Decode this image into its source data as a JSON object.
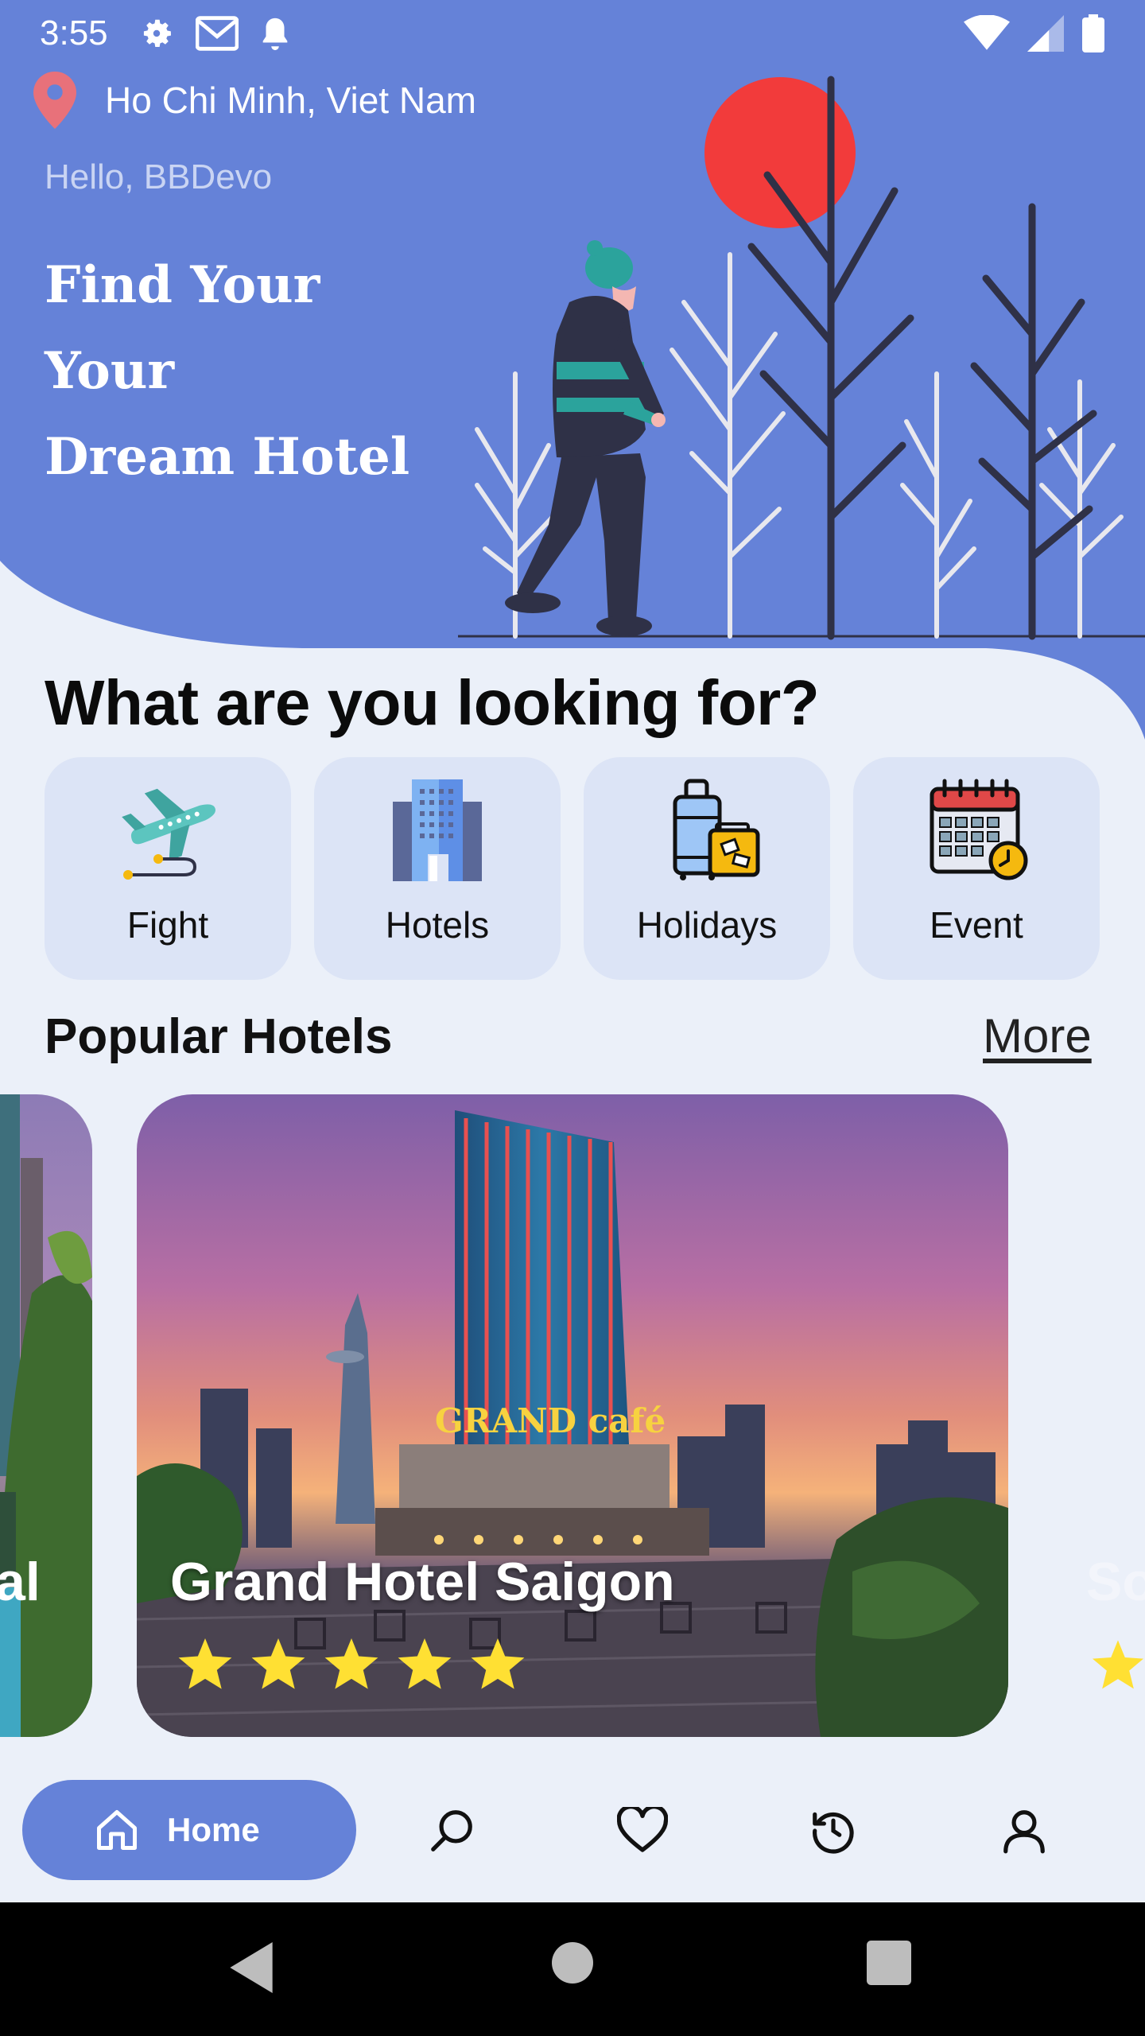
{
  "colors": {
    "primary": "#6582D8",
    "background": "#EBF0F9",
    "card": "#DCE4F6",
    "sun": "#F23B3B",
    "star": "#FFE033"
  },
  "status_bar": {
    "time": "3:55",
    "icons": [
      "settings-icon",
      "gmail-icon",
      "notification-bell-icon",
      "wifi-icon",
      "signal-icon",
      "battery-icon"
    ]
  },
  "header": {
    "location": "Ho Chi Minh, Viet Nam",
    "greeting": "Hello, BBDevo",
    "title_lines": [
      "Find Your",
      "Your",
      "Dream Hotel"
    ]
  },
  "categories_section": {
    "title": "What are you looking for?",
    "items": [
      {
        "label": "Fight",
        "icon": "airplane-icon"
      },
      {
        "label": "Hotels",
        "icon": "hotel-building-icon"
      },
      {
        "label": "Holidays",
        "icon": "luggage-icon"
      },
      {
        "label": "Event",
        "icon": "calendar-icon"
      }
    ]
  },
  "popular_section": {
    "title": "Popular Hotels",
    "more_label": "More",
    "hotels": [
      {
        "name": "al"
      },
      {
        "name": "Grand Hotel Saigon",
        "rating": 5
      },
      {
        "name": "So"
      }
    ]
  },
  "bottom_nav": {
    "home_label": "Home",
    "items": [
      "home-icon",
      "search-icon",
      "heart-icon",
      "history-icon",
      "profile-icon"
    ]
  },
  "system_nav": [
    "back-icon",
    "home-circle-icon",
    "recents-icon"
  ]
}
